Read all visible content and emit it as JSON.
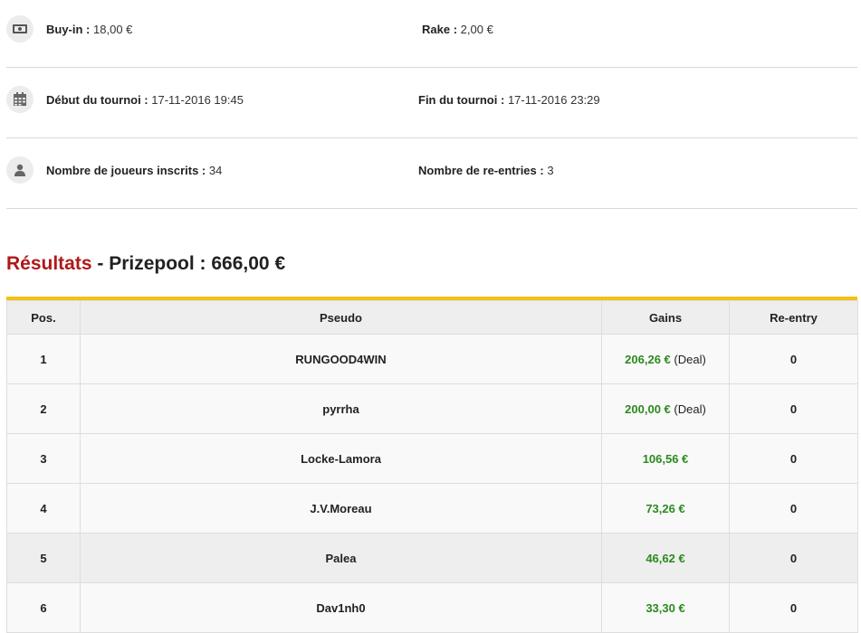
{
  "info": {
    "buyin": {
      "label": "Buy-in :",
      "value": "18,00 €"
    },
    "rake": {
      "label": "Rake :",
      "value": "2,00 €"
    },
    "debut": {
      "label": "Début du tournoi :",
      "value": "17-11-2016 19:45"
    },
    "fin": {
      "label": "Fin du tournoi :",
      "value": "17-11-2016 23:29"
    },
    "joueurs": {
      "label": "Nombre de joueurs inscrits :",
      "value": "34"
    },
    "reentries": {
      "label": "Nombre de re-entries :",
      "value": "3"
    }
  },
  "results": {
    "title": "Résultats",
    "separator": " - ",
    "prizepool": "Prizepool : 666,00 €"
  },
  "table": {
    "headers": [
      "Pos.",
      "Pseudo",
      "Gains",
      "Re-entry"
    ],
    "rows": [
      {
        "pos": "1",
        "pseudo": "RUNGOOD4WIN",
        "gain": "206,26 €",
        "note": "(Deal)",
        "reentry": "0"
      },
      {
        "pos": "2",
        "pseudo": "pyrrha",
        "gain": "200,00 €",
        "note": "(Deal)",
        "reentry": "0"
      },
      {
        "pos": "3",
        "pseudo": "Locke-Lamora",
        "gain": "106,56 €",
        "note": "",
        "reentry": "0"
      },
      {
        "pos": "4",
        "pseudo": "J.V.Moreau",
        "gain": "73,26 €",
        "note": "",
        "reentry": "0"
      },
      {
        "pos": "5",
        "pseudo": "Palea",
        "gain": "46,62 €",
        "note": "",
        "reentry": "0"
      },
      {
        "pos": "6",
        "pseudo": "Dav1nh0",
        "gain": "33,30 €",
        "note": "",
        "reentry": "0"
      }
    ]
  },
  "colors": {
    "accent_bar": "#f5c016",
    "title_red": "#b01818",
    "gain_green": "#2b8a1e"
  },
  "icons": [
    "money-icon",
    "calendar-icon",
    "user-icon"
  ]
}
